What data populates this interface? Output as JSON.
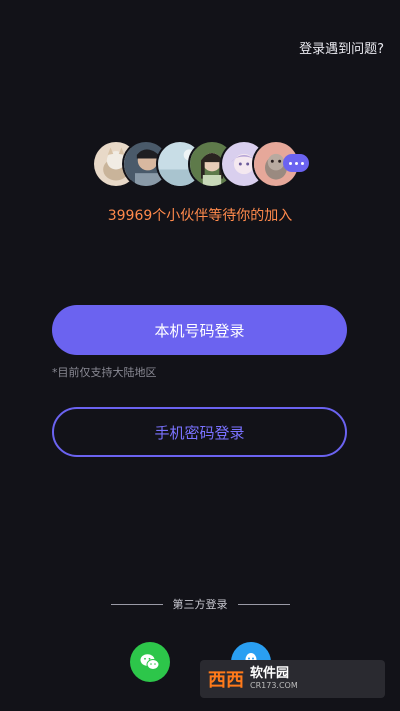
{
  "header": {
    "help_link": "登录遇到问题?"
  },
  "community": {
    "avatars": [
      {
        "name": "avatar-cat",
        "bg": "#e8d9c8"
      },
      {
        "name": "avatar-man",
        "bg": "#4a5a6a"
      },
      {
        "name": "avatar-sky",
        "bg": "#c8dde6"
      },
      {
        "name": "avatar-girl",
        "bg": "#5e7a4a"
      },
      {
        "name": "avatar-anime",
        "bg": "#d9cfee"
      },
      {
        "name": "avatar-dog",
        "bg": "#e6a89a"
      }
    ],
    "more_icon": "more-dots-icon",
    "invite_text": "39969个小伙伴等待你的加入"
  },
  "login": {
    "primary_label": "本机号码登录",
    "note": "*目前仅支持大陆地区",
    "secondary_label": "手机密码登录"
  },
  "third_party": {
    "label": "第三方登录",
    "options": [
      "wechat-icon",
      "qq-icon"
    ]
  },
  "watermark": {
    "logo": "西西",
    "site": "软件园",
    "url": "CR173.COM"
  },
  "colors": {
    "accent": "#6b63f0",
    "invite": "#ff8a4c",
    "background": "#121218",
    "wechat": "#2dc64a",
    "qq": "#2a9ff2"
  }
}
